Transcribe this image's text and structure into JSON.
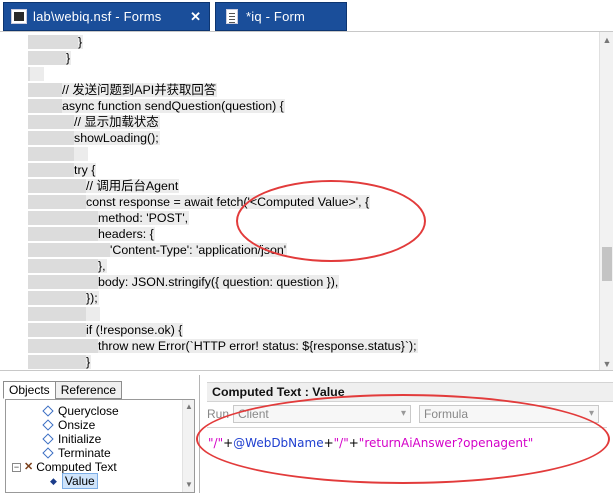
{
  "tabs": [
    {
      "label": "lab\\webiq.nsf - Forms",
      "close": "✕",
      "icon": "database-icon"
    },
    {
      "label": "*iq - Form",
      "close": "",
      "icon": "form-icon"
    }
  ],
  "code_lines": [
    {
      "indent": 78,
      "text": "}"
    },
    {
      "indent": 66,
      "text": "}"
    },
    {
      "indent": 30,
      "text": ""
    },
    {
      "indent": 62,
      "text": "// 发送问题到API并获取回答"
    },
    {
      "indent": 62,
      "text": "async function sendQuestion(question) {"
    },
    {
      "indent": 74,
      "text": "// 显示加载状态"
    },
    {
      "indent": 74,
      "text": "showLoading();"
    },
    {
      "indent": 74,
      "text": ""
    },
    {
      "indent": 74,
      "text": "try {"
    },
    {
      "indent": 86,
      "text": "// 调用后台Agent"
    },
    {
      "indent": 86,
      "text": "const response = await fetch('<Computed Value>', {"
    },
    {
      "indent": 98,
      "text": "method: 'POST',"
    },
    {
      "indent": 98,
      "text": "headers: {"
    },
    {
      "indent": 110,
      "text": "'Content-Type': 'application/json'"
    },
    {
      "indent": 98,
      "text": "},"
    },
    {
      "indent": 98,
      "text": "body: JSON.stringify({ question: question }),"
    },
    {
      "indent": 86,
      "text": "});"
    },
    {
      "indent": 86,
      "text": ""
    },
    {
      "indent": 86,
      "text": "if (!response.ok) {"
    },
    {
      "indent": 98,
      "text": "throw new Error(`HTTP error! status: ${response.status}`);"
    },
    {
      "indent": 86,
      "text": "}"
    }
  ],
  "left_pane": {
    "tabs": [
      "Objects",
      "Reference"
    ],
    "tree": [
      {
        "label": "Queryclose",
        "kind": "event"
      },
      {
        "label": "Onsize",
        "kind": "event"
      },
      {
        "label": "Initialize",
        "kind": "event"
      },
      {
        "label": "Terminate",
        "kind": "event"
      },
      {
        "label": "Computed Text",
        "kind": "parent",
        "expander": "−"
      },
      {
        "label": "Value",
        "kind": "selected"
      }
    ]
  },
  "right_pane": {
    "title": "Computed Text : Value",
    "run_label": "Run",
    "run_value": "Client",
    "type_value": "Formula",
    "formula_parts": [
      {
        "text": "\"/\"",
        "kind": "str"
      },
      {
        "text": "+",
        "kind": "op"
      },
      {
        "text": "@WebDbName",
        "kind": "var"
      },
      {
        "text": "+",
        "kind": "op"
      },
      {
        "text": "\"/\"",
        "kind": "str"
      },
      {
        "text": "+",
        "kind": "op"
      },
      {
        "text": "\"returnAiAnswer?openagent\"",
        "kind": "str"
      }
    ]
  },
  "colors": {
    "tab_bg": "#1a4e9a",
    "annotation": "#e23b3b",
    "formula_string": "#d400c8",
    "formula_variable": "#1f3fd0"
  }
}
